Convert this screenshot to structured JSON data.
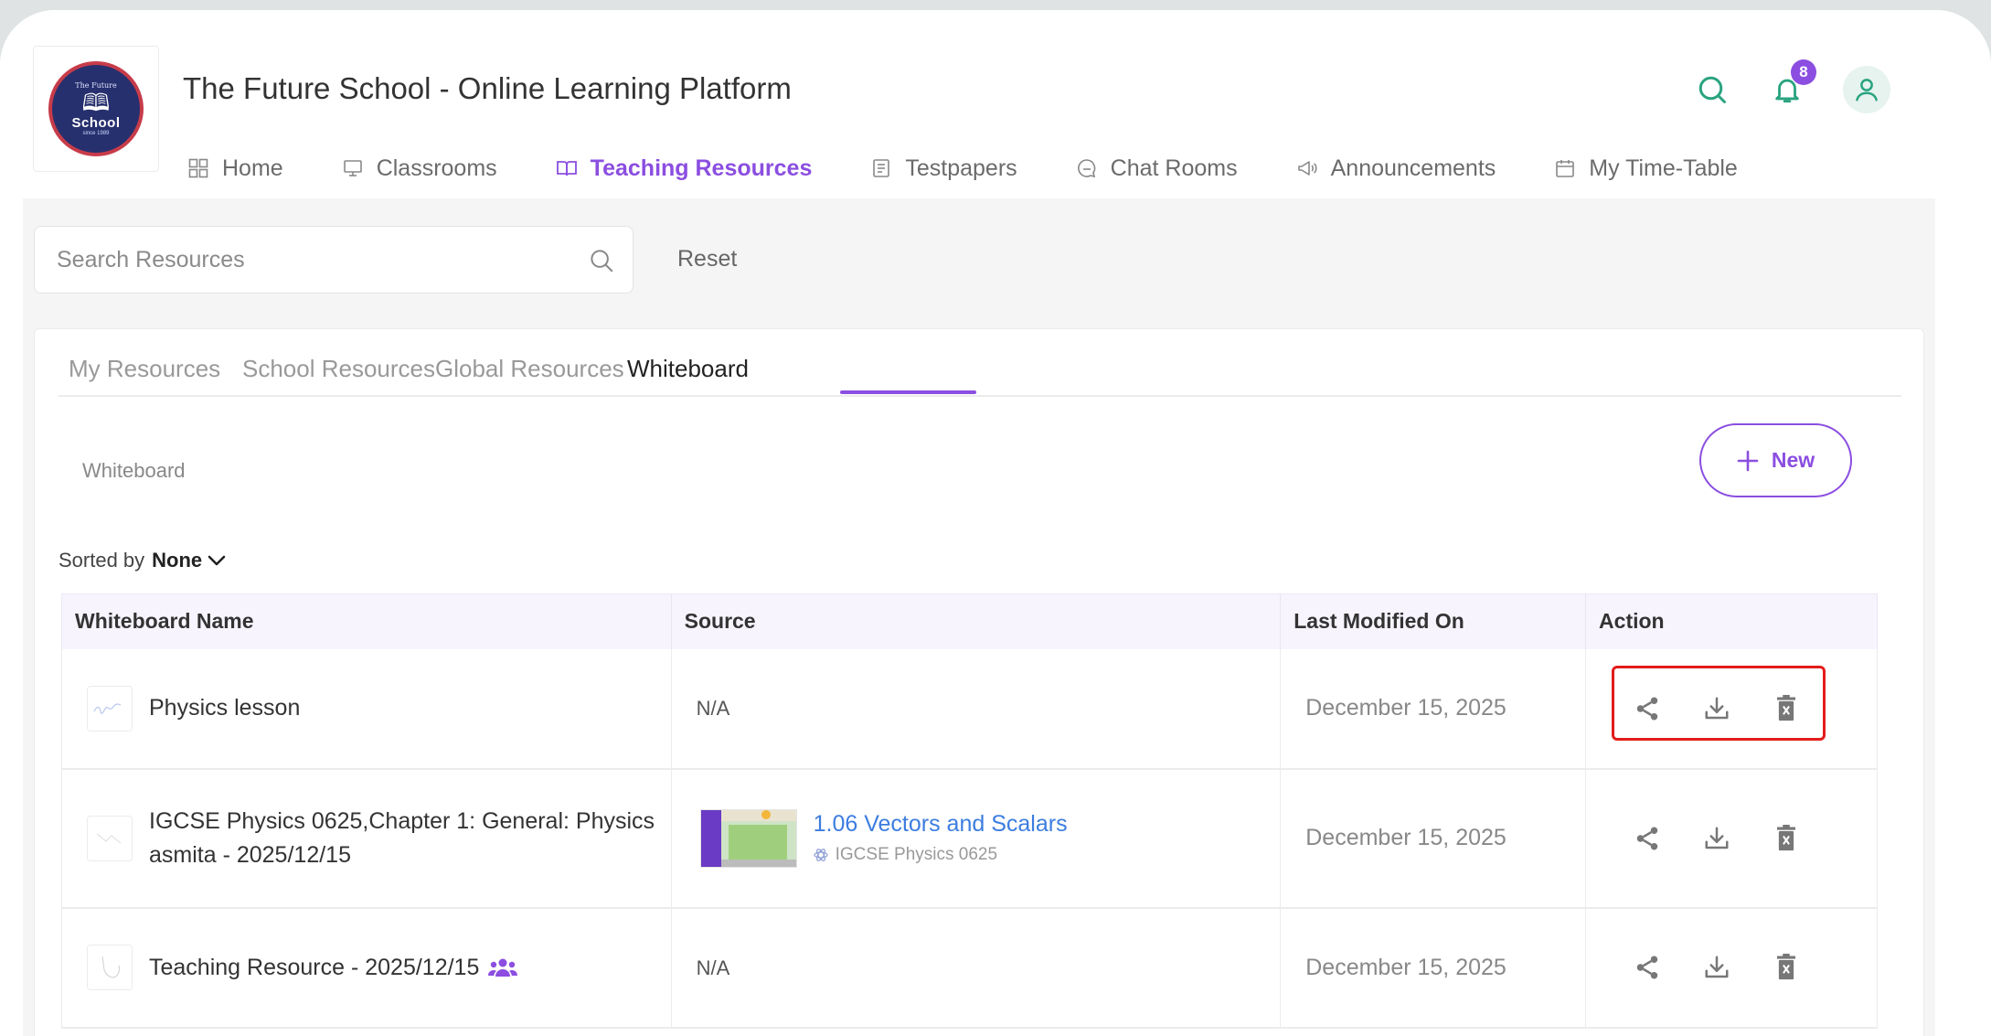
{
  "app": {
    "title": "The Future School - Online Learning Platform",
    "notification_count": "8"
  },
  "logo": {
    "top_text": "The Future",
    "school_text": "School",
    "bottom_text": "since 1989"
  },
  "nav": [
    {
      "label": "Home",
      "icon": "grid-icon"
    },
    {
      "label": "Classrooms",
      "icon": "monitor-icon"
    },
    {
      "label": "Teaching Resources",
      "icon": "book-icon"
    },
    {
      "label": "Testpapers",
      "icon": "document-icon"
    },
    {
      "label": "Chat Rooms",
      "icon": "chat-icon"
    },
    {
      "label": "Announcements",
      "icon": "megaphone-icon"
    },
    {
      "label": "My Time-Table",
      "icon": "calendar-icon"
    }
  ],
  "search": {
    "placeholder": "Search Resources",
    "value": "",
    "reset_label": "Reset"
  },
  "tabs": [
    {
      "label": "My Resources"
    },
    {
      "label": "School Resources"
    },
    {
      "label": "Global Resources"
    },
    {
      "label": "Whiteboard"
    }
  ],
  "breadcrumb": "Whiteboard",
  "new_button": "New",
  "sort": {
    "label": "Sorted by",
    "value": "None"
  },
  "table": {
    "columns": [
      "Whiteboard Name",
      "Source",
      "Last Modified On",
      "Action"
    ],
    "rows": [
      {
        "name": "Physics lesson",
        "source": "N/A",
        "modified": "December 15, 2025"
      },
      {
        "name_line1": "IGCSE Physics 0625,Chapter 1: General: Physics",
        "name_line2": "asmita - 2025/12/15",
        "source_title": "1.06 Vectors and Scalars",
        "source_subject": "IGCSE Physics 0625",
        "modified": "December 15, 2025"
      },
      {
        "name": "Teaching Resource - 2025/12/15",
        "source": "N/A",
        "modified": "December 15, 2025"
      }
    ]
  },
  "colors": {
    "accent": "#8b4ee0",
    "link": "#3c7de0",
    "teal_icon": "#2aa37f",
    "highlight": "#e31c1c"
  }
}
